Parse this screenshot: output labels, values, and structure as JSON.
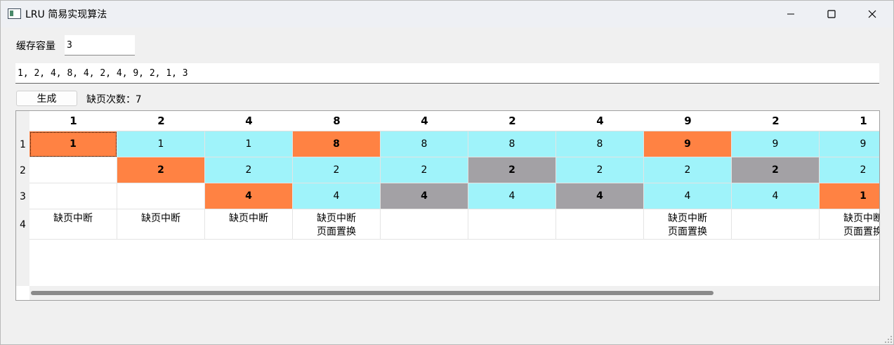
{
  "window": {
    "title": "LRU 简易实现算法",
    "icon": "app-window-icon"
  },
  "controls": {
    "capacity_label": "缓存容量",
    "capacity_value": "3",
    "sequence_value": "1, 2, 4, 8, 4, 2, 4, 9, 2, 1, 3",
    "generate_label": "生成",
    "fault_label": "缺页次数：",
    "fault_count": "7"
  },
  "table": {
    "row_headers": [
      "1",
      "2",
      "3",
      "4"
    ],
    "columns": [
      "1",
      "2",
      "4",
      "8",
      "4",
      "2",
      "4",
      "9",
      "2",
      "1"
    ],
    "rows": [
      [
        [
          "1",
          "load"
        ],
        [
          "1",
          "hit"
        ],
        [
          "1",
          "hit"
        ],
        [
          "8",
          "load"
        ],
        [
          "8",
          "hit"
        ],
        [
          "8",
          "hit"
        ],
        [
          "8",
          "hit"
        ],
        [
          "9",
          "load"
        ],
        [
          "9",
          "hit"
        ],
        [
          "9",
          "hit"
        ]
      ],
      [
        [
          "",
          "empty"
        ],
        [
          "2",
          "load"
        ],
        [
          "2",
          "hit"
        ],
        [
          "2",
          "hit"
        ],
        [
          "2",
          "hit"
        ],
        [
          "2",
          "evict"
        ],
        [
          "2",
          "hit"
        ],
        [
          "2",
          "hit"
        ],
        [
          "2",
          "evict"
        ],
        [
          "2",
          "hit"
        ]
      ],
      [
        [
          "",
          "empty"
        ],
        [
          "",
          "empty"
        ],
        [
          "4",
          "load"
        ],
        [
          "4",
          "hit"
        ],
        [
          "4",
          "evict"
        ],
        [
          "4",
          "hit"
        ],
        [
          "4",
          "evict"
        ],
        [
          "4",
          "hit"
        ],
        [
          "4",
          "hit"
        ],
        [
          "1",
          "load"
        ]
      ]
    ],
    "status": [
      [
        "缺页中断",
        ""
      ],
      [
        "缺页中断",
        ""
      ],
      [
        "缺页中断",
        ""
      ],
      [
        "缺页中断",
        "页面置换"
      ],
      [
        "",
        ""
      ],
      [
        "",
        ""
      ],
      [
        "",
        ""
      ],
      [
        "缺页中断",
        "页面置换"
      ],
      [
        "",
        ""
      ],
      [
        "缺页中断",
        "页面置换"
      ]
    ],
    "colors": {
      "hit": "#9ff3fa",
      "load": "#ff8243",
      "evict": "#a3a1a5"
    }
  }
}
